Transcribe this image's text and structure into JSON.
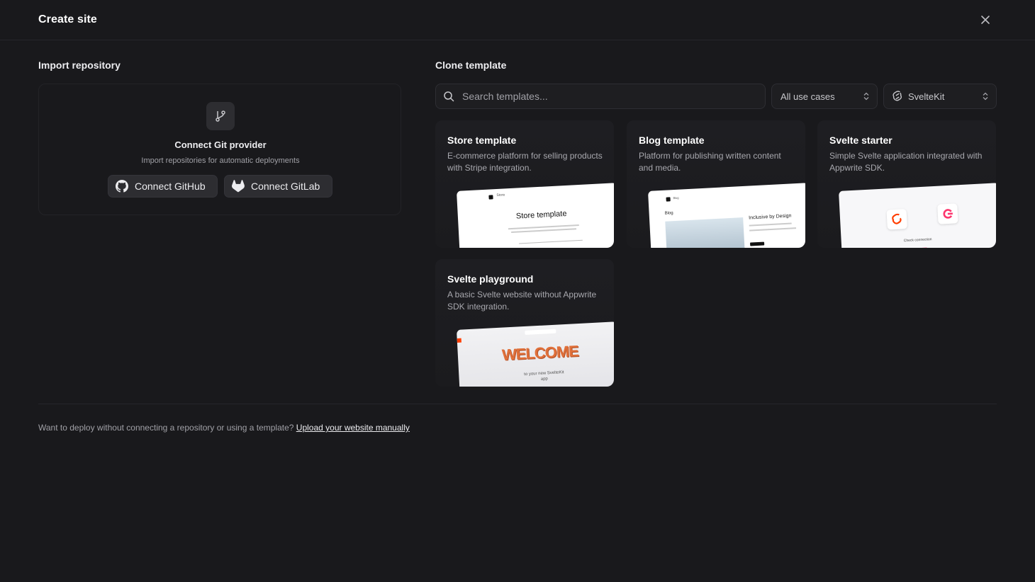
{
  "header": {
    "title": "Create site"
  },
  "import": {
    "section_title": "Import repository",
    "heading": "Connect Git provider",
    "subtitle": "Import repositories for automatic deployments",
    "github_label": "Connect GitHub",
    "gitlab_label": "Connect GitLab"
  },
  "clone": {
    "section_title": "Clone template",
    "search_placeholder": "Search templates...",
    "use_case_filter": "All use cases",
    "framework_filter": "SvelteKit",
    "templates": [
      {
        "name": "Store template",
        "description": "E-commerce platform for selling products with Stripe integration.",
        "preview": {
          "brand": "Store",
          "heading": "Store template"
        }
      },
      {
        "name": "Blog template",
        "description": "Platform for publishing written content and media.",
        "preview": {
          "brand": "Blog",
          "heading": "Blog",
          "article": "Inclusive by Design"
        }
      },
      {
        "name": "Svelte starter",
        "description": "Simple Svelte application integrated with Appwrite SDK.",
        "preview": {
          "caption": "Check connection"
        }
      },
      {
        "name": "Svelte playground",
        "description": "A basic Svelte website without Appwrite SDK integration.",
        "preview": {
          "heading": "WELCOME",
          "subheading": "to your new SvelteKit app"
        }
      }
    ]
  },
  "footer": {
    "text": "Want to deploy without connecting a repository or using a template?",
    "link": "Upload your website manually"
  },
  "colors": {
    "background": "#19191c",
    "card": "#1e1e22",
    "button": "#2d2d31",
    "svelte_orange": "#ff3e00",
    "appwrite_pink": "#fd366e"
  },
  "icons": [
    "close-icon",
    "git-branch-icon",
    "github-icon",
    "gitlab-icon",
    "search-icon",
    "chevron-updown-icon",
    "svelte-icon"
  ]
}
